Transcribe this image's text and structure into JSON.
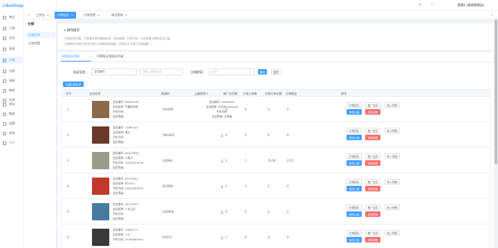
{
  "app": {
    "logo": "LikeShop",
    "user": "管理1 (系统管理员)"
  },
  "sidebar": {
    "items": [
      {
        "label": "商品",
        "icon": "goods-icon"
      },
      {
        "label": "订单",
        "icon": "order-icon"
      },
      {
        "label": "会员",
        "icon": "user-icon"
      },
      {
        "label": "营销",
        "icon": "marketing-icon"
      },
      {
        "label": "分销",
        "icon": "distribution-icon",
        "active": true
      },
      {
        "label": "内容",
        "icon": "content-icon"
      },
      {
        "label": "装修",
        "icon": "decorate-icon"
      },
      {
        "label": "微信",
        "icon": "wechat-icon"
      },
      {
        "label": "应用",
        "icon": "app-icon"
      },
      {
        "label": "财务",
        "icon": "finance-icon"
      },
      {
        "label": "数据",
        "icon": "data-icon"
      },
      {
        "label": "设置",
        "icon": "settings-icon"
      },
      {
        "label": "系统",
        "icon": "system-icon"
      },
      {
        "label": "个人",
        "icon": "person-icon"
      }
    ]
  },
  "submenu": {
    "title": "分销",
    "items": [
      "分销分享",
      "分销设置"
    ]
  },
  "tabs": [
    {
      "label": "工作台",
      "active": false
    },
    {
      "label": "分销会员",
      "active": true
    },
    {
      "label": "分销设置",
      "active": false
    },
    {
      "label": "商品管理",
      "active": false
    }
  ],
  "notice": {
    "title": "操作提示",
    "lines": [
      "*分销会员列表，可查看分销的基础信息、冻结金额、分销订单，以及查看分销的会员上级；",
      "*分销时在分销订单中可进行分销佣金的结算（并发后才可进行分销结算）。"
    ]
  },
  "list": {
    "tabs": [
      "分销会员列表",
      "待审核分销会员列表"
    ],
    "filters": {
      "member_label": "会员信息",
      "member_select": "会员编号",
      "member_placeholder": "请输入搜索内容",
      "status_label": "分销状态",
      "status_placeholder": "全部"
    },
    "query": "查询",
    "reset": "重置",
    "open_btn": "开通分销会员",
    "columns": [
      "序号",
      "会员信息",
      "邀请码",
      "上级推荐人",
      "推广会员数",
      "分销订单数",
      "分销订单金额",
      "分销佣金",
      "操作"
    ],
    "rows": [
      {
        "no": "1",
        "info": [
          "会员编号: 62831918",
          "会员昵称: 平藤的的家",
          "手机号码:",
          "会员等级:"
        ],
        "code": "ZYKZP8",
        "parent": [
          "会员编号: 90086901",
          "会员昵称: 在大街LikeShop",
          "手机号码:",
          "会员等级: 无等级"
        ],
        "fans": "0",
        "orders": "0",
        "amount": "0",
        "commission": "0",
        "avatar": "#8a6a4a"
      },
      {
        "no": "2",
        "info": [
          "会员编号: 71863202",
          "会员昵称: 溜立",
          "手机号码:",
          "会员等级:"
        ],
        "code": "5WGKS1",
        "parent": [
          "无"
        ],
        "fans": "0",
        "orders": "0",
        "amount": "0",
        "commission": "0",
        "avatar": "#6b3a2a"
      },
      {
        "no": "3",
        "info": [
          "会员编号: 81913636",
          "会员昵称: 小栗子",
          "手机号码: 15622028756",
          "会员等级:"
        ],
        "code": "SUJ984",
        "parent": [
          "无"
        ],
        "fans": "2",
        "orders": "1",
        "amount": "33.00",
        "commission": "0.55",
        "avatar": "#9a9a8a"
      },
      {
        "no": "4",
        "info": [
          "会员编号: 63473302",
          "会员昵称: 阿7500",
          "手机号码: 15879383032",
          "会员等级:"
        ],
        "code": "KCGBW",
        "parent": [
          "无"
        ],
        "fans": "0",
        "orders": "0",
        "amount": "0",
        "commission": "0",
        "avatar": "#c0392b"
      },
      {
        "no": "5",
        "info": [
          "会员编号: 06153674",
          "会员昵称: 人在云后",
          "手机号码:",
          "会员等级:"
        ],
        "code": "U4ZNA8",
        "parent": [
          "无"
        ],
        "fans": "0",
        "orders": "0",
        "amount": "0",
        "commission": "0",
        "avatar": "#4a7aa0"
      },
      {
        "no": "6",
        "info": [
          "会员编号: 21863771",
          "会员昵称: 十心",
          "手机号码: 15394840091",
          ""
        ],
        "code": "6YDC4",
        "parent": [
          "无"
        ],
        "fans": "1",
        "orders": "0",
        "amount": "0",
        "commission": "0",
        "avatar": "#3a3a3a"
      }
    ],
    "ops": {
      "a": "分销团队",
      "b": "推广会员",
      "c": "收入明细",
      "d": "修改上级",
      "e": "冻结资格"
    }
  }
}
